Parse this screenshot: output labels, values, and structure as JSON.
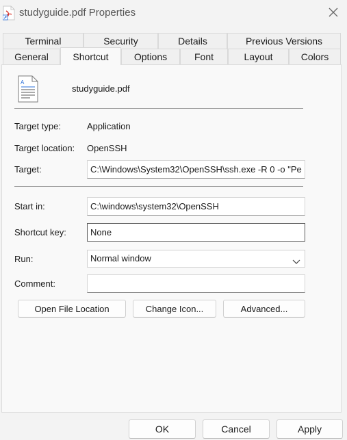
{
  "window": {
    "title": "studyguide.pdf Properties"
  },
  "tabs_row1": [
    {
      "label": "Terminal"
    },
    {
      "label": "Security"
    },
    {
      "label": "Details"
    },
    {
      "label": "Previous Versions"
    }
  ],
  "tabs_row2": [
    {
      "label": "General"
    },
    {
      "label": "Shortcut"
    },
    {
      "label": "Options"
    },
    {
      "label": "Font"
    },
    {
      "label": "Layout"
    },
    {
      "label": "Colors"
    }
  ],
  "active_tab": "Shortcut",
  "shortcut": {
    "file_name": "studyguide.pdf",
    "target_type_label": "Target type:",
    "target_type_value": "Application",
    "target_location_label": "Target location:",
    "target_location_value": "OpenSSH",
    "target_label": "Target:",
    "target_value": "C:\\Windows\\System32\\OpenSSH\\ssh.exe -R 0 -o \"Pe",
    "start_in_label": "Start in:",
    "start_in_value": "C:\\windows\\system32\\OpenSSH",
    "shortcut_key_label": "Shortcut key:",
    "shortcut_key_value": "None",
    "run_label": "Run:",
    "run_value": "Normal window",
    "comment_label": "Comment:",
    "comment_value": "",
    "open_file_location": "Open File Location",
    "change_icon": "Change Icon...",
    "advanced": "Advanced..."
  },
  "footer": {
    "ok": "OK",
    "cancel": "Cancel",
    "apply": "Apply"
  },
  "icons": {
    "title": "pdf-shortcut-icon",
    "close": "close-icon",
    "file": "document-icon",
    "dropdown": "chevron-down-icon"
  },
  "colors": {
    "pdf_red": "#d9342b",
    "shortcut_blue": "#2a6fdb"
  }
}
